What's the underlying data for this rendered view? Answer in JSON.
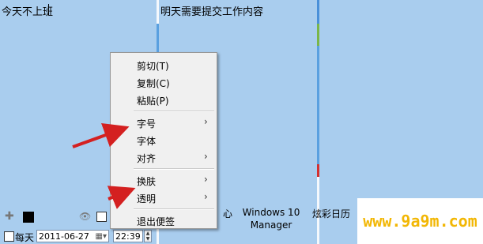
{
  "notes": {
    "left_text": "今天不上班",
    "middle_text": "明天需要提交工作内容"
  },
  "toolbar": {
    "add_icon": "plus-icon",
    "color_value": "#000000",
    "eye_icon": "eye-icon",
    "daily_label": "每天",
    "date_value": "2011-06-27",
    "calendar_icon": "calendar-icon",
    "time_value": "22:39"
  },
  "taskbar": {
    "item1": "心",
    "item2_line1": "Windows 10",
    "item2_line2": "Manager",
    "item3": "炫彩日历"
  },
  "context_menu": {
    "items": [
      {
        "label": "剪切(T)",
        "submenu": false
      },
      {
        "label": "复制(C)",
        "submenu": false
      },
      {
        "label": "粘贴(P)",
        "submenu": false
      },
      {
        "label": "字号",
        "submenu": true
      },
      {
        "label": "字体",
        "submenu": false
      },
      {
        "label": "对齐",
        "submenu": true
      },
      {
        "label": "换肤",
        "submenu": true
      },
      {
        "label": "透明",
        "submenu": true
      },
      {
        "label": "退出便签",
        "submenu": false
      }
    ],
    "arrow_glyph": "›"
  },
  "watermark": "www.9a9m.com",
  "colors": {
    "note_bg": "#a9cdee",
    "annotation_arrow": "#d42020",
    "watermark": "#f2b705"
  }
}
